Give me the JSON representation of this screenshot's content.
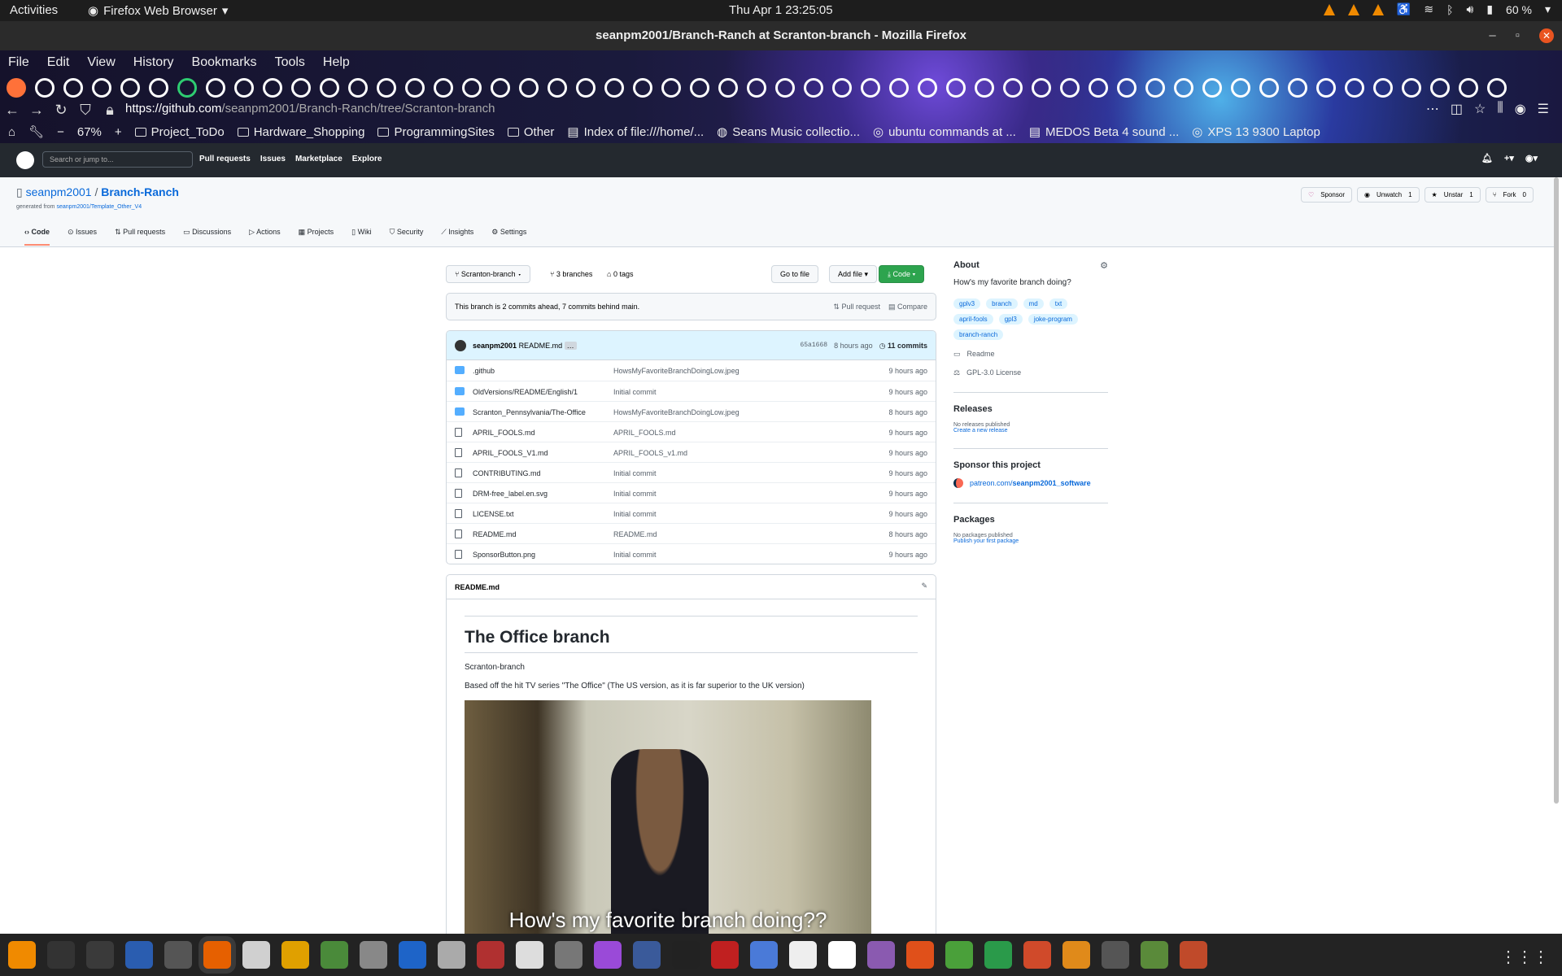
{
  "topbar": {
    "activities": "Activities",
    "app_name": "Firefox Web Browser",
    "clock": "Thu Apr 1  23:25:05",
    "battery": "60 %"
  },
  "window": {
    "title": "seanpm2001/Branch-Ranch at Scranton-branch - Mozilla Firefox"
  },
  "firefox": {
    "menu": [
      "File",
      "Edit",
      "View",
      "History",
      "Bookmarks",
      "Tools",
      "Help"
    ],
    "url_prefix": "https://github.com",
    "url_rest": "/seanpm2001/Branch-Ranch/tree/Scranton-branch",
    "zoom": "67%",
    "bookmarks": [
      "Project_ToDo",
      "Hardware_Shopping",
      "ProgrammingSites",
      "Other",
      "Index of file:///home/...",
      "Seans Music collectio...",
      "ubuntu commands at ...",
      "MEDOS Beta 4 sound ...",
      "XPS 13 9300 Laptop"
    ]
  },
  "github": {
    "search_placeholder": "Search or jump to...",
    "nav": [
      "Pull requests",
      "Issues",
      "Marketplace",
      "Explore"
    ]
  },
  "repo": {
    "owner": "seanpm2001",
    "name": "Branch-Ranch",
    "generated_label": "generated from",
    "generated_from": "seanpm2001/Template_Other_V4",
    "actions": {
      "sponsor": "Sponsor",
      "unwatch": "Unwatch",
      "watch_count": "1",
      "unstar": "Unstar",
      "star_count": "1",
      "fork": "Fork",
      "fork_count": "0"
    },
    "tabs": [
      "Code",
      "Issues",
      "Pull requests",
      "Discussions",
      "Actions",
      "Projects",
      "Wiki",
      "Security",
      "Insights",
      "Settings"
    ]
  },
  "main": {
    "branch": "Scranton-branch",
    "branches": "3 branches",
    "tags": "0 tags",
    "go_to_file": "Go to file",
    "add_file": "Add file",
    "code": "Code",
    "ahead_text": "This branch is 2 commits ahead, 7 commits behind main.",
    "pull_request": "Pull request",
    "compare": "Compare",
    "commit": {
      "author": "seanpm2001",
      "message": "README.md",
      "hash": "65a1668",
      "age": "8 hours ago",
      "count": "11 commits"
    },
    "files": [
      {
        "type": "folder",
        "name": ".github",
        "msg": "HowsMyFavoriteBranchDoingLow.jpeg",
        "age": "9 hours ago"
      },
      {
        "type": "folder",
        "name": "OldVersions/README/English/1",
        "msg": "Initial commit",
        "age": "9 hours ago"
      },
      {
        "type": "folder",
        "name": "Scranton_Pennsylvania/The-Office",
        "msg": "HowsMyFavoriteBranchDoingLow.jpeg",
        "age": "8 hours ago"
      },
      {
        "type": "file",
        "name": "APRIL_FOOLS.md",
        "msg": "APRIL_FOOLS.md",
        "age": "9 hours ago"
      },
      {
        "type": "file",
        "name": "APRIL_FOOLS_V1.md",
        "msg": "APRIL_FOOLS_v1.md",
        "age": "9 hours ago"
      },
      {
        "type": "file",
        "name": "CONTRIBUTING.md",
        "msg": "Initial commit",
        "age": "9 hours ago"
      },
      {
        "type": "file",
        "name": "DRM-free_label.en.svg",
        "msg": "Initial commit",
        "age": "9 hours ago"
      },
      {
        "type": "file",
        "name": "LICENSE.txt",
        "msg": "Initial commit",
        "age": "9 hours ago"
      },
      {
        "type": "file",
        "name": "README.md",
        "msg": "README.md",
        "age": "8 hours ago"
      },
      {
        "type": "file",
        "name": "SponsorButton.png",
        "msg": "Initial commit",
        "age": "9 hours ago"
      }
    ],
    "readme": {
      "filename": "README.md",
      "heading": "The Office branch",
      "p1": "Scranton-branch",
      "p2": "Based off the hit TV series \"The Office\" (The US version, as it is far superior to the UK version)",
      "image_caption": "How's my favorite branch doing??"
    }
  },
  "sidebar": {
    "about_title": "About",
    "description": "How's my favorite branch doing?",
    "topics": [
      "gplv3",
      "branch",
      "md",
      "txt",
      "april-fools",
      "gpl3",
      "joke-program",
      "branch-ranch"
    ],
    "readme": "Readme",
    "license": "GPL-3.0 License",
    "releases_title": "Releases",
    "no_releases": "No releases published",
    "create_release": "Create a new release",
    "sponsor_title": "Sponsor this project",
    "patreon_prefix": "patreon.com/",
    "patreon_user": "seanpm2001_software",
    "packages_title": "Packages",
    "no_packages": "No packages published",
    "publish_package": "Publish your first package"
  }
}
